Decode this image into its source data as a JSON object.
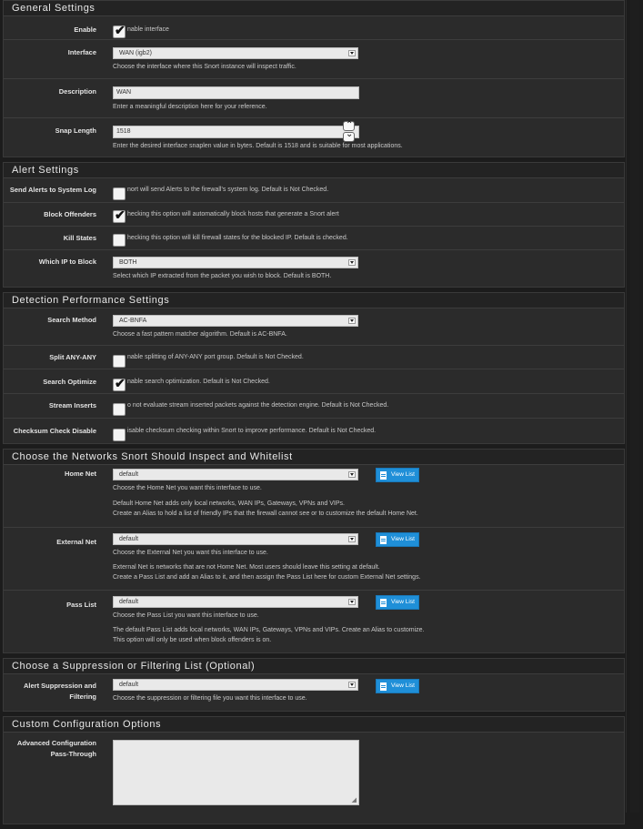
{
  "general": {
    "title": "General Settings",
    "enable": {
      "label": "Enable",
      "text": "nable interface",
      "checked": true
    },
    "interface": {
      "label": "Interface",
      "value": "WAN (igb2)",
      "help": "Choose the interface where this Snort instance will inspect traffic."
    },
    "description": {
      "label": "Description",
      "value": "WAN",
      "help": "Enter a meaningful description here for your reference."
    },
    "snaplen": {
      "label": "Snap Length",
      "value": "1518",
      "help": "Enter the desired interface snaplen value in bytes. Default is 1518 and is suitable for most applications."
    }
  },
  "alert": {
    "title": "Alert Settings",
    "syslog": {
      "label": "Send Alerts to System Log",
      "text": "nort will send Alerts to the firewall's system log. Default is Not Checked.",
      "checked": false
    },
    "block": {
      "label": "Block Offenders",
      "text": "hecking this option will automatically block hosts that generate a Snort alert",
      "checked": true
    },
    "kill": {
      "label": "Kill States",
      "text": "hecking this option will kill firewall states for the blocked IP. Default is checked.",
      "checked": false
    },
    "whichip": {
      "label": "Which IP to Block",
      "value": "BOTH",
      "help": "Select which IP extracted from the packet you wish to block. Default is BOTH."
    }
  },
  "detection": {
    "title": "Detection Performance Settings",
    "method": {
      "label": "Search Method",
      "value": "AC-BNFA",
      "help": "Choose a fast pattern matcher algorithm. Default is AC-BNFA."
    },
    "split": {
      "label": "Split ANY-ANY",
      "text": "nable splitting of ANY-ANY port group. Default is Not Checked.",
      "checked": false
    },
    "optimize": {
      "label": "Search Optimize",
      "text": "nable search optimization. Default is Not Checked.",
      "checked": true
    },
    "stream": {
      "label": "Stream Inserts",
      "text": "o not evaluate stream inserted packets against the detection engine. Default is Not Checked.",
      "checked": false
    },
    "checksum": {
      "label": "Checksum Check Disable",
      "text": "isable checksum checking within Snort to improve performance. Default is Not Checked.",
      "checked": false
    }
  },
  "networks": {
    "title": "Choose the Networks Snort Should Inspect and Whitelist",
    "view_label": "View List",
    "home": {
      "label": "Home Net",
      "value": "default",
      "help1": "Choose the Home Net you want this interface to use.",
      "help2": "Default Home Net adds only local networks, WAN IPs, Gateways, VPNs and VIPs.",
      "help3": "Create an Alias to hold a list of friendly IPs that the firewall cannot see or to customize the default Home Net."
    },
    "external": {
      "label": "External Net",
      "value": "default",
      "help1": "Choose the External Net you want this interface to use.",
      "help2": "External Net is networks that are not Home Net. Most users should leave this setting at default.",
      "help3": "Create a Pass List and add an Alias to it, and then assign the Pass List here for custom External Net settings."
    },
    "pass": {
      "label": "Pass List",
      "value": "default",
      "help1": "Choose the Pass List you want this interface to use.",
      "help2": "The default Pass List adds local networks, WAN IPs, Gateways, VPNs and VIPs. Create an Alias to customize.",
      "help3": "This option will only be used when block offenders is on."
    }
  },
  "suppression": {
    "title": "Choose a Suppression or Filtering List (Optional)",
    "label1": "Alert Suppression and",
    "label2": "Filtering",
    "value": "default",
    "help": "Choose the suppression or filtering file you want this interface to use.",
    "view_label": "View List"
  },
  "custom": {
    "title": "Custom Configuration Options",
    "label1": "Advanced Configuration",
    "label2": "Pass-Through",
    "value": ""
  }
}
